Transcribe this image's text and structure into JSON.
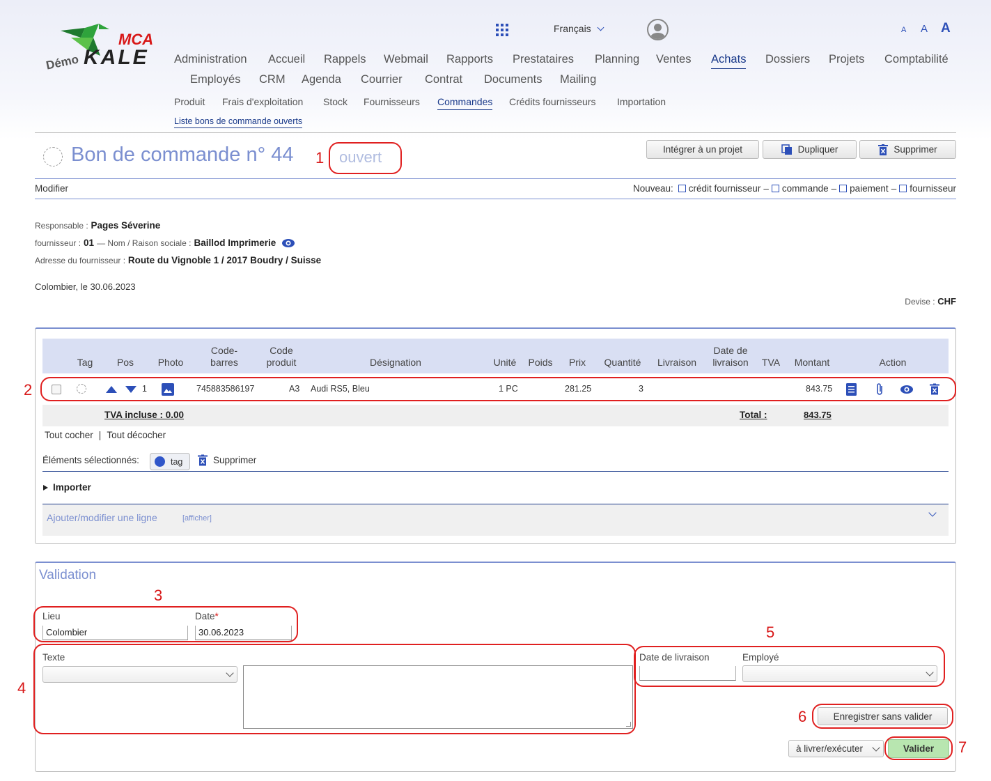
{
  "logo": {
    "brand": "MCA",
    "product": "KALE",
    "demo": "Démo"
  },
  "header": {
    "language": "Français",
    "font_sizes": [
      "A",
      "A",
      "A"
    ]
  },
  "main_menu": {
    "row1": [
      "Administration",
      "Accueil",
      "Rappels",
      "Webmail",
      "Rapports",
      "Prestataires",
      "Planning",
      "Ventes",
      "Achats",
      "Dossiers",
      "Projets",
      "Comptabilité"
    ],
    "row2": [
      "Employés",
      "CRM",
      "Agenda",
      "Courrier",
      "Contrat",
      "Documents",
      "Mailing"
    ],
    "active": "Achats"
  },
  "sub_menu": {
    "items": [
      "Produit",
      "Frais d'exploitation",
      "Stock",
      "Fournisseurs",
      "Commandes",
      "Crédits fournisseurs",
      "Importation"
    ],
    "active": "Commandes",
    "sub2": "Liste bons de commande ouverts"
  },
  "title": {
    "text": "Bon de commande n° 44",
    "status": "ouvert"
  },
  "actions": {
    "integrate": "Intégrer à un projet",
    "duplicate": "Dupliquer",
    "delete": "Supprimer"
  },
  "toolbar": {
    "modify": "Modifier",
    "new_label": "Nouveau:",
    "new_links": [
      "crédit fournisseur",
      "commande",
      "paiement",
      "fournisseur"
    ],
    "separator": "–"
  },
  "info": {
    "responsable_label": "Responsable :",
    "responsable": "Pages Séverine",
    "supplier_label": "fournisseur :",
    "supplier_no": "01",
    "name_label": "— Nom / Raison sociale :",
    "supplier_name": "Baillod Imprimerie",
    "address_label": "Adresse du fournisseur :",
    "address": "Route du Vignoble 1 / 2017 Boudry / Suisse",
    "place_date": "Colombier, le 30.06.2023",
    "currency_label": "Devise :",
    "currency": "CHF"
  },
  "table": {
    "headers": {
      "tag": "Tag",
      "pos": "Pos",
      "photo": "Photo",
      "barcode_1": "Code-",
      "barcode_2": "barres",
      "code_1": "Code",
      "code_2": "produit",
      "designation": "Désignation",
      "unit": "Unité",
      "weight": "Poids",
      "price": "Prix",
      "quantity": "Quantité",
      "delivery": "Livraison",
      "delivery_date_1": "Date de",
      "delivery_date_2": "livraison",
      "vat": "TVA",
      "amount": "Montant",
      "action": "Action"
    },
    "rows": [
      {
        "pos": "1",
        "barcode": "745883586197",
        "code": "A3",
        "designation": "Audi RS5, Bleu",
        "unit": "1 PC",
        "weight": "",
        "price": "281.25",
        "quantity": "3",
        "delivery": "",
        "delivery_date": "",
        "vat": "",
        "amount": "843.75"
      }
    ],
    "vat_included": "TVA incluse : 0.00",
    "total_label": "Total :",
    "total": "843.75"
  },
  "selection": {
    "check_all": "Tout cocher",
    "separator": "|",
    "uncheck_all": "Tout décocher",
    "selected_label": "Éléments sélectionnés:",
    "tag": "tag",
    "delete": "Supprimer"
  },
  "import": {
    "label": "Importer"
  },
  "add_line": {
    "label": "Ajouter/modifier une ligne",
    "show": "[afficher]"
  },
  "validation": {
    "title": "Validation",
    "place_label": "Lieu",
    "place": "Colombier",
    "date_label": "Date",
    "required": "*",
    "date": "30.06.2023",
    "text_label": "Texte",
    "delivery_date_label": "Date de livraison",
    "employee_label": "Employé",
    "save_without": "Enregistrer sans valider",
    "status_select": "à livrer/exécuter",
    "validate": "Valider"
  },
  "annotations": [
    "1",
    "2",
    "3",
    "4",
    "5",
    "6",
    "7"
  ],
  "colors": {
    "accent": "#1a3a8a",
    "title": "#7b8fd0",
    "table_header": "#d9dff3",
    "annotation": "#e02020",
    "validate": "#b8e6b0"
  }
}
